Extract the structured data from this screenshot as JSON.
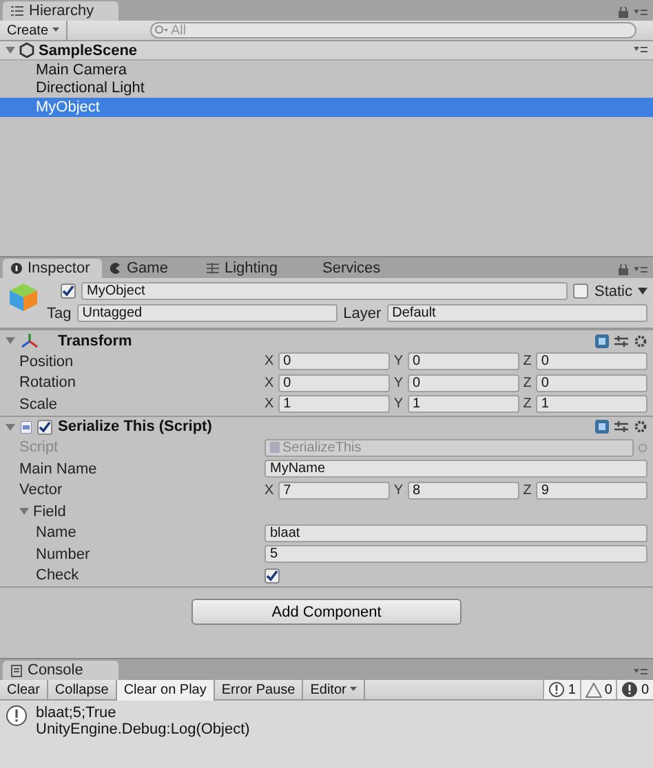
{
  "hierarchy": {
    "tab": "Hierarchy",
    "create_button": "Create",
    "search_placeholder": "All",
    "scene": {
      "name": "SampleScene",
      "expanded": true
    },
    "items": [
      {
        "label": "Main Camera",
        "selected": false
      },
      {
        "label": "Directional Light",
        "selected": false
      },
      {
        "label": "MyObject",
        "selected": true
      }
    ]
  },
  "inspector": {
    "tabs": [
      {
        "label": "Inspector",
        "selected": true
      },
      {
        "label": "Game",
        "selected": false
      },
      {
        "label": "Lighting",
        "selected": false
      },
      {
        "label": "Services",
        "selected": false
      }
    ],
    "object": {
      "active": true,
      "name": "MyObject",
      "static": false,
      "static_label": "Static",
      "tag_label": "Tag",
      "tag": "Untagged",
      "layer_label": "Layer",
      "layer": "Default"
    },
    "components": [
      {
        "title": "Transform",
        "kind": "transform",
        "expanded": true,
        "rows": [
          {
            "kind": "vector",
            "label": "Position",
            "axes": [
              {
                "axis": "X",
                "value": "0"
              },
              {
                "axis": "Y",
                "value": "0"
              },
              {
                "axis": "Z",
                "value": "0"
              }
            ]
          },
          {
            "kind": "vector",
            "label": "Rotation",
            "axes": [
              {
                "axis": "X",
                "value": "0"
              },
              {
                "axis": "Y",
                "value": "0"
              },
              {
                "axis": "Z",
                "value": "0"
              }
            ]
          },
          {
            "kind": "vector",
            "label": "Scale",
            "axes": [
              {
                "axis": "X",
                "value": "1"
              },
              {
                "axis": "Y",
                "value": "1"
              },
              {
                "axis": "Z",
                "value": "1"
              }
            ]
          }
        ]
      },
      {
        "title": "Serialize This (Script)",
        "kind": "script",
        "expanded": true,
        "enabled": true,
        "rows": [
          {
            "kind": "object",
            "label": "Script",
            "value": "SerializeThis",
            "disabled": true
          },
          {
            "kind": "text",
            "label": "Main Name",
            "value": "MyName"
          },
          {
            "kind": "vector",
            "label": "Vector",
            "axes": [
              {
                "axis": "X",
                "value": "7"
              },
              {
                "axis": "Y",
                "value": "8"
              },
              {
                "axis": "Z",
                "value": "9"
              }
            ]
          },
          {
            "kind": "foldout",
            "label": "Field",
            "expanded": true,
            "children": [
              {
                "kind": "text",
                "label": "Name",
                "value": "blaat"
              },
              {
                "kind": "text",
                "label": "Number",
                "value": "5"
              },
              {
                "kind": "checkbox",
                "label": "Check",
                "checked": true
              }
            ]
          }
        ]
      }
    ],
    "add_component": "Add Component"
  },
  "console": {
    "tab": "Console",
    "buttons": [
      {
        "label": "Clear",
        "selected": false
      },
      {
        "label": "Collapse",
        "selected": false
      },
      {
        "label": "Clear on Play",
        "selected": true
      },
      {
        "label": "Error Pause",
        "selected": false
      },
      {
        "label": "Editor",
        "selected": false,
        "dropdown": true
      }
    ],
    "counts": [
      {
        "kind": "info",
        "value": "1"
      },
      {
        "kind": "warning",
        "value": "0"
      },
      {
        "kind": "error",
        "value": "0"
      }
    ],
    "logs": [
      {
        "kind": "info",
        "lines": [
          "blaat;5;True",
          "UnityEngine.Debug:Log(Object)"
        ]
      }
    ]
  }
}
